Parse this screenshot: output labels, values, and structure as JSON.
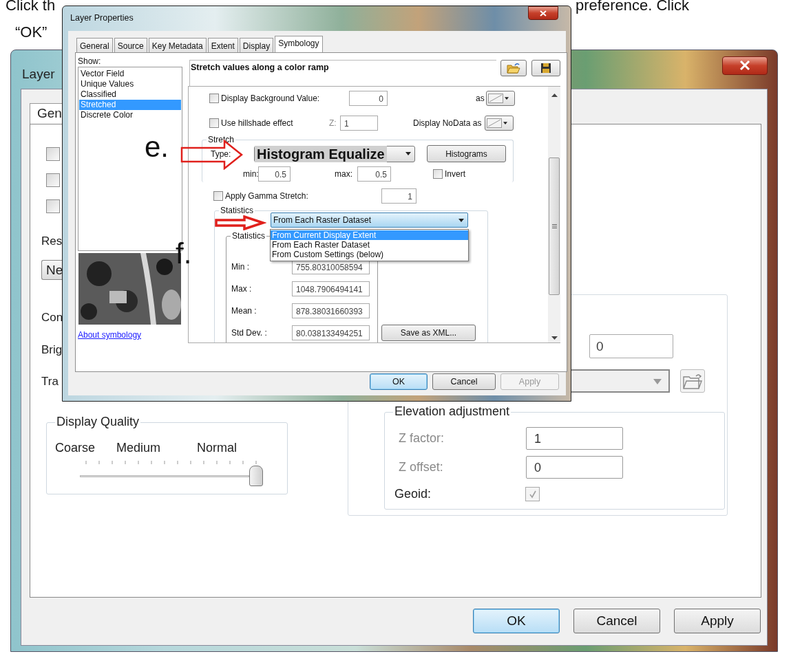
{
  "instruction": {
    "line_1_start": "Click th",
    "line_1_end": "preference. Click",
    "line_2": "“OK”"
  },
  "back_window": {
    "title": "Layer",
    "tabs": [
      {
        "label": "Gen",
        "selected": true
      }
    ],
    "left_items": [
      {
        "kind": "checkbox",
        "checked": false
      },
      {
        "kind": "checkbox",
        "checked": false
      },
      {
        "kind": "checkbox",
        "checked": false
      },
      {
        "kind": "label",
        "text": "Res"
      },
      {
        "kind": "dropdown",
        "text": "Ne"
      },
      {
        "kind": "label",
        "text": "Con"
      },
      {
        "kind": "label",
        "text": "Brig"
      },
      {
        "kind": "label",
        "text": "Tra"
      }
    ],
    "display_quality": {
      "title": "Display Quality",
      "labels": [
        "Coarse",
        "Medium",
        "Normal"
      ],
      "level": 1
    },
    "field_value": "0",
    "elevation": {
      "title": "Elevation adjustment",
      "rows": [
        {
          "kind": "field",
          "label": "Z factor:",
          "label_greyed": true,
          "value": "1"
        },
        {
          "kind": "field",
          "label": "Z offset:",
          "label_greyed": true,
          "value": "0"
        },
        {
          "kind": "checkbox",
          "label": "Geoid:",
          "label_greyed": false,
          "checked": true,
          "disabled": true
        }
      ]
    },
    "buttons": [
      {
        "label": "OK",
        "default": true,
        "disabled": false
      },
      {
        "label": "Cancel",
        "default": false,
        "disabled": false
      },
      {
        "label": "Apply",
        "default": false,
        "disabled": false
      }
    ]
  },
  "dialog": {
    "title": "Layer Properties",
    "tabs": [
      {
        "label": "General",
        "selected": false
      },
      {
        "label": "Source",
        "selected": false
      },
      {
        "label": "Key Metadata",
        "selected": false
      },
      {
        "label": "Extent",
        "selected": false
      },
      {
        "label": "Display",
        "selected": false
      },
      {
        "label": "Symbology",
        "selected": true
      }
    ],
    "show_label": "Show:",
    "renderers": [
      {
        "label": "Vector Field",
        "selected": false
      },
      {
        "label": "Unique Values",
        "selected": false
      },
      {
        "label": "Classified",
        "selected": false
      },
      {
        "label": "Stretched",
        "selected": true
      },
      {
        "label": "Discrete Color",
        "selected": false
      }
    ],
    "link": "About symbology",
    "heading": "Stretch values along a color ramp",
    "background_value": {
      "label": "Display Background Value:",
      "checked": false,
      "value": "0",
      "as_label": "as"
    },
    "hillshade": {
      "label": "Use hillshade effect",
      "checked": false,
      "z_label": "Z:",
      "z_value": "1",
      "nodata_label": "Display NoData as"
    },
    "stretch": {
      "title": "Stretch",
      "type_label": "Type:",
      "type_value": "Histogram Equalize",
      "histograms_button": "Histograms",
      "min_label": "min:",
      "min_value": "0.5",
      "max_label": "max:",
      "max_value": "0.5",
      "invert": {
        "label": "Invert",
        "checked": false
      }
    },
    "gamma": {
      "label": "Apply Gamma Stretch:",
      "checked": false,
      "value": "1"
    },
    "statistics": {
      "title": "Statistics",
      "source": "From Each Raster Dataset",
      "options": [
        {
          "label": "From Current Display Extent",
          "selected": true
        },
        {
          "label": "From Each Raster Dataset",
          "selected": false
        },
        {
          "label": "From Custom Settings (below)",
          "selected": false
        }
      ],
      "inner_title": "Statistics",
      "rows": [
        {
          "label": "Min :",
          "value": "755.80310058594"
        },
        {
          "label": "Max :",
          "value": "1048.7906494141"
        },
        {
          "label": "Mean :",
          "value": "878.38031660393"
        },
        {
          "label": "Std Dev. :",
          "value": "80.038133494251"
        }
      ],
      "save_button": "Save as XML..."
    },
    "buttons": [
      {
        "label": "OK",
        "default": true,
        "disabled": false
      },
      {
        "label": "Cancel",
        "default": false,
        "disabled": false
      },
      {
        "label": "Apply",
        "default": false,
        "disabled": true
      }
    ]
  },
  "annotations": [
    {
      "label": "e."
    },
    {
      "label": "f."
    }
  ]
}
